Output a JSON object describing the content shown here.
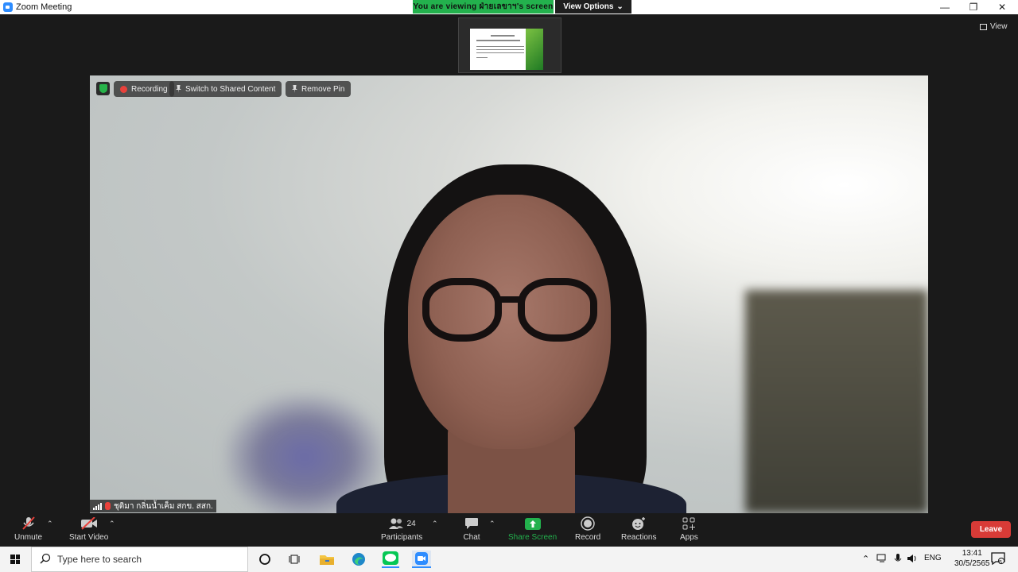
{
  "window": {
    "title": "Zoom Meeting"
  },
  "banner": {
    "viewing_text": "You are viewing ฝ่ายเลขาฯ's screen",
    "view_options": "View Options"
  },
  "view_button": "View",
  "overlay": {
    "recording": "Recording",
    "switch_shared": "Switch to Shared Content",
    "remove_pin": "Remove Pin"
  },
  "participant_name": "ชุติมา กลิ่นน้ำเค็ม สกข. สสก.",
  "toolbar": {
    "unmute": "Unmute",
    "start_video": "Start Video",
    "participants": "Participants",
    "participants_count": "24",
    "chat": "Chat",
    "share_screen": "Share Screen",
    "record": "Record",
    "reactions": "Reactions",
    "apps": "Apps",
    "leave": "Leave"
  },
  "taskbar": {
    "search_placeholder": "Type here to search",
    "language": "ENG",
    "time": "13:41",
    "date": "30/5/2565",
    "notification_count": "5"
  },
  "colors": {
    "share_green": "#23b14d",
    "leave_red": "#d83b37",
    "recording_red": "#e8413b"
  }
}
